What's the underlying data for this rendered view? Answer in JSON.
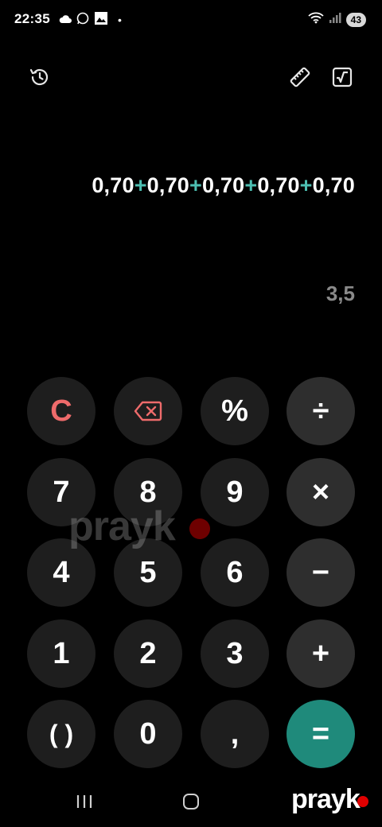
{
  "status_bar": {
    "time": "22:35",
    "dot": "•",
    "battery": "43"
  },
  "toolbar": {
    "history_icon": "history-icon",
    "ruler_icon": "ruler-icon",
    "scientific_icon": "square-root-icon"
  },
  "display": {
    "expression": {
      "terms": [
        "0,70",
        "0,70",
        "0,70",
        "0,70",
        "0,70"
      ],
      "operator": "+"
    },
    "result": "3,5"
  },
  "keypad": {
    "clear": "C",
    "backspace_icon": "backspace-icon",
    "percent": "%",
    "divide": "÷",
    "seven": "7",
    "eight": "8",
    "nine": "9",
    "multiply": "×",
    "four": "4",
    "five": "5",
    "six": "6",
    "minus": "−",
    "one": "1",
    "two": "2",
    "three": "3",
    "plus": "+",
    "parentheses": "( )",
    "zero": "0",
    "decimal": ",",
    "equals": "="
  },
  "watermark": "prayk",
  "brand": "prayk",
  "colors": {
    "background": "#000000",
    "key": "#1e1e1e",
    "operator_key": "#2e2e2e",
    "equals": "#1f8a7b",
    "accent_operator": "#4dbfb2",
    "clear": "#ee6b6b",
    "result": "#8a8a8a"
  }
}
